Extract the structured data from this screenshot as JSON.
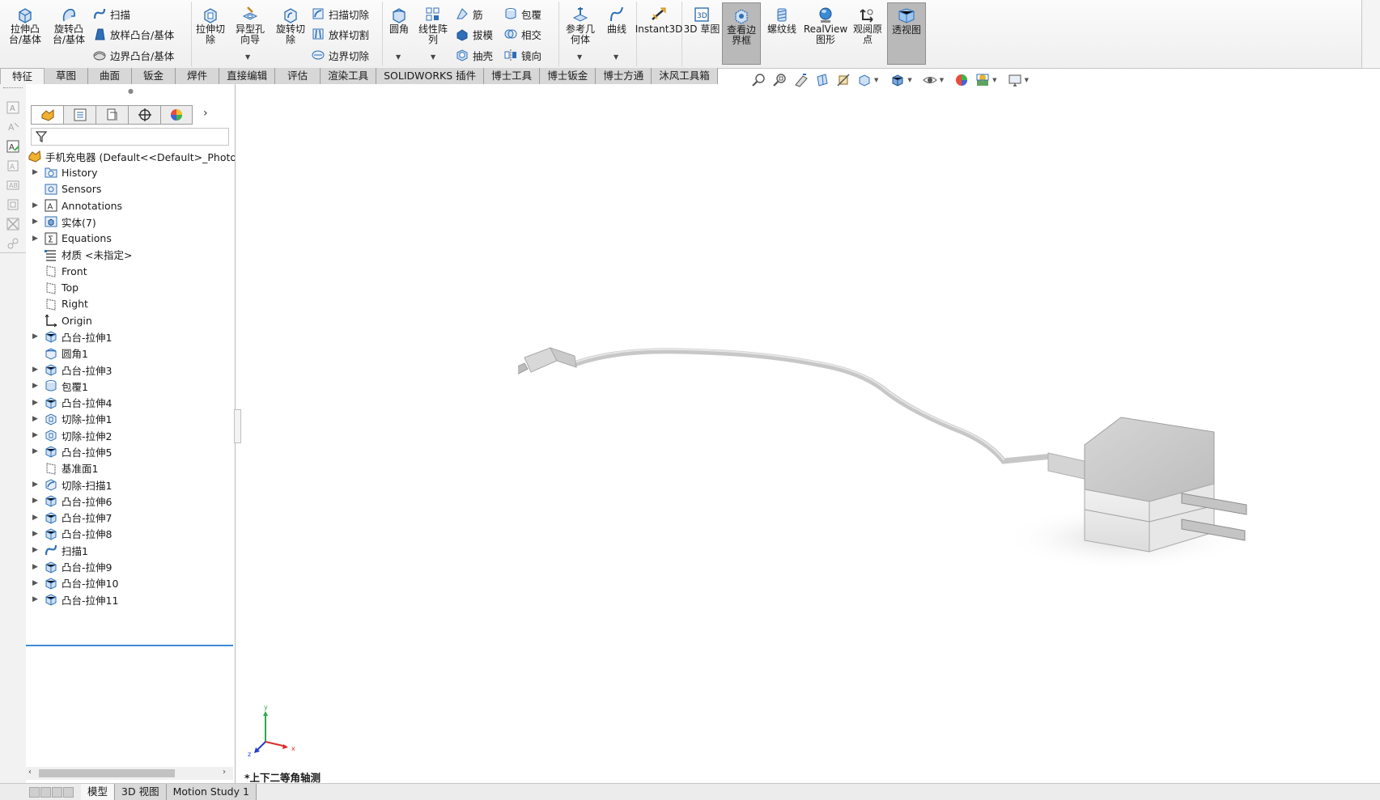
{
  "ribbon": {
    "features": {
      "extrude_boss": "拉伸凸\n台/基体",
      "revolve_boss": "旋转凸\n台/基体",
      "sweep": "扫描",
      "loft_boss": "放样凸台/基体",
      "boundary_boss": "边界凸台/基体",
      "extrude_cut": "拉伸切\n除",
      "hole_wizard": "异型孔\n向导",
      "revolve_cut": "旋转切\n除",
      "sweep_cut": "扫描切除",
      "loft_cut": "放样切割",
      "boundary_cut": "边界切除",
      "fillet": "圆角",
      "linear_pattern": "线性阵\n列",
      "rib": "筋",
      "draft": "拔模",
      "shell": "抽壳",
      "wrap": "包覆",
      "intersect": "相交",
      "mirror": "镜向",
      "ref_geometry": "参考几\n何体",
      "curves": "曲线",
      "instant3d": "Instant3D",
      "sketch3d": "3D 草图",
      "bounding_box": "查看边\n界框",
      "thread": "螺纹线",
      "realview": "RealView\n图形",
      "view_origin": "观阅原\n点",
      "perspective": "透视图"
    },
    "tabs": [
      "特征",
      "草图",
      "曲面",
      "钣金",
      "焊件",
      "直接编辑",
      "评估",
      "渲染工具",
      "SOLIDWORKS 插件",
      "博士工具",
      "博士钣金",
      "博士方通",
      "沐风工具箱"
    ]
  },
  "feature_tree": {
    "root": "手机充电器  (Default<<Default>_PhotoW",
    "items": [
      {
        "label": "History",
        "icon": "history-folder-icon",
        "expandable": true
      },
      {
        "label": "Sensors",
        "icon": "sensor-icon",
        "expandable": false
      },
      {
        "label": "Annotations",
        "icon": "annotation-icon",
        "expandable": true
      },
      {
        "label": "实体(7)",
        "icon": "solid-bodies-icon",
        "expandable": true
      },
      {
        "label": "Equations",
        "icon": "equations-icon",
        "expandable": true
      },
      {
        "label": "材质 <未指定>",
        "icon": "material-icon",
        "expandable": false
      },
      {
        "label": "Front",
        "icon": "plane-icon",
        "expandable": false
      },
      {
        "label": "Top",
        "icon": "plane-icon",
        "expandable": false
      },
      {
        "label": "Right",
        "icon": "plane-icon",
        "expandable": false
      },
      {
        "label": "Origin",
        "icon": "origin-icon",
        "expandable": false
      },
      {
        "label": "凸台-拉伸1",
        "icon": "boss-extrude-icon",
        "expandable": true
      },
      {
        "label": "圆角1",
        "icon": "fillet-feature-icon",
        "expandable": false
      },
      {
        "label": "凸台-拉伸3",
        "icon": "boss-extrude-icon",
        "expandable": true
      },
      {
        "label": "包覆1",
        "icon": "wrap-feature-icon",
        "expandable": true
      },
      {
        "label": "凸台-拉伸4",
        "icon": "boss-extrude-icon",
        "expandable": true
      },
      {
        "label": "切除-拉伸1",
        "icon": "cut-extrude-icon",
        "expandable": true
      },
      {
        "label": "切除-拉伸2",
        "icon": "cut-extrude-icon",
        "expandable": true
      },
      {
        "label": "凸台-拉伸5",
        "icon": "boss-extrude-icon",
        "expandable": true
      },
      {
        "label": "基准面1",
        "icon": "plane-icon",
        "expandable": false
      },
      {
        "label": "切除-扫描1",
        "icon": "cut-sweep-icon",
        "expandable": true
      },
      {
        "label": "凸台-拉伸6",
        "icon": "boss-extrude-icon",
        "expandable": true
      },
      {
        "label": "凸台-拉伸7",
        "icon": "boss-extrude-icon",
        "expandable": true
      },
      {
        "label": "凸台-拉伸8",
        "icon": "boss-extrude-icon",
        "expandable": true
      },
      {
        "label": "扫描1",
        "icon": "sweep-feature-icon",
        "expandable": true
      },
      {
        "label": "凸台-拉伸9",
        "icon": "boss-extrude-icon",
        "expandable": true
      },
      {
        "label": "凸台-拉伸10",
        "icon": "boss-extrude-icon",
        "expandable": true
      },
      {
        "label": "凸台-拉伸11",
        "icon": "boss-extrude-icon",
        "expandable": true
      }
    ]
  },
  "viewport": {
    "view_name": "*上下二等角轴测",
    "triad": {
      "x": "x",
      "y": "y",
      "z": "z"
    }
  },
  "bottom_tabs": [
    "模型",
    "3D 视图",
    "Motion Study 1"
  ],
  "colors": {
    "accent": "#3f8ad4",
    "active_button": "#b9b9b9",
    "icon_blue": "#2e6fb7",
    "tab_gray": "#d7d7d7"
  }
}
